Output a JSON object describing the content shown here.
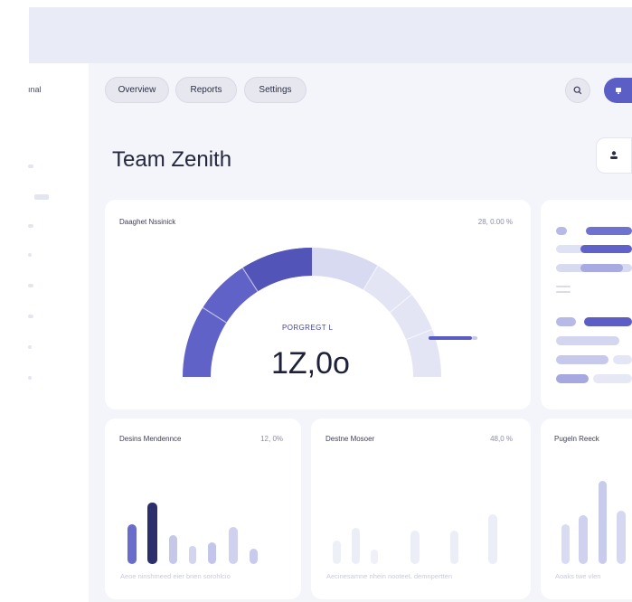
{
  "sidebar": {
    "brand_label": "ınal"
  },
  "nav": {
    "tabs": [
      {
        "label": "Overview"
      },
      {
        "label": "Reports"
      },
      {
        "label": "Settings"
      }
    ],
    "search_icon": "search-icon",
    "notification_icon": "bell-icon"
  },
  "page": {
    "title": "Team Zenith",
    "user_icon": "user-icon"
  },
  "gauge_card": {
    "label": "Daaghet Nssinick",
    "value": "28, 0.00 %",
    "gauge_label": "PORGREGT L",
    "gauge_value": "1Z,0o",
    "progress": 0.5
  },
  "cards": [
    {
      "label": "Desins Mendennce",
      "value": "12, 0%",
      "caption": "Aeoe ninshmeed eier bnen sorohlcio"
    },
    {
      "label": "Destne Mosoer",
      "value": "48,0 %",
      "caption": "Aecinesamne nhein nooteeL demnpertten"
    },
    {
      "label": "Pugeln Reeck",
      "value": "",
      "caption": "Aoaks twe vlen"
    }
  ],
  "colors": {
    "accent": "#6062c8",
    "accent_dark": "#2b2e6a",
    "accent_light": "#d6d8f0",
    "background": "#f4f5fa"
  }
}
